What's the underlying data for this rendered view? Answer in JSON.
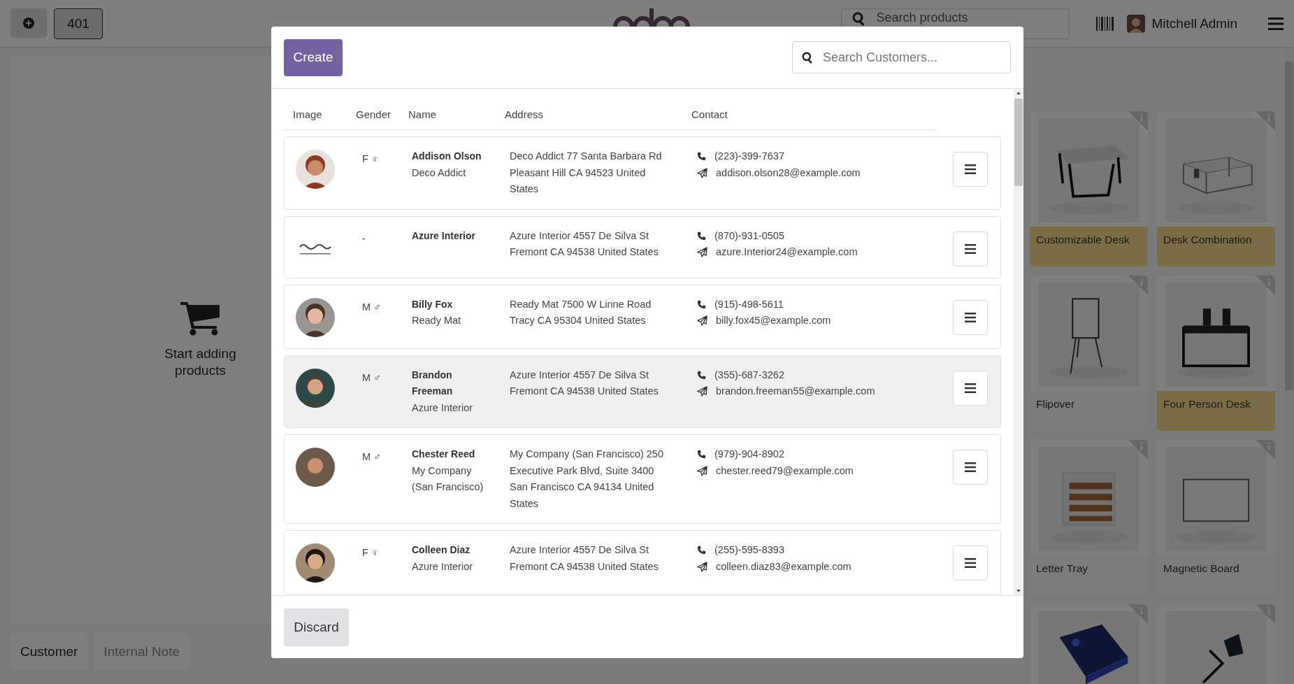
{
  "topbar": {
    "order_number": "401",
    "search": {
      "placeholder": "Search products"
    },
    "user": "Mitchell Admin"
  },
  "order_panel": {
    "empty_message": "Start adding products",
    "buttons": [
      "Customer",
      "Internal Note"
    ]
  },
  "products": [
    {
      "name": "Customizable Desk",
      "highlighted": true,
      "kind": "desk"
    },
    {
      "name": "Desk Combination",
      "highlighted": true,
      "kind": "combo"
    },
    {
      "name": "Flipover",
      "highlighted": false,
      "kind": "flipover"
    },
    {
      "name": "Four Person Desk",
      "highlighted": true,
      "kind": "fourdesk"
    },
    {
      "name": "Letter Tray",
      "highlighted": false,
      "kind": "tray"
    },
    {
      "name": "Magnetic Board",
      "highlighted": false,
      "kind": "board"
    },
    {
      "kind": "box"
    },
    {
      "kind": "lamp"
    }
  ],
  "dialog": {
    "create_button": "Create",
    "search": {
      "placeholder": "Search Customers..."
    },
    "columns": [
      "Image",
      "Gender",
      "Name",
      "Address",
      "Contact"
    ],
    "customers": [
      {
        "gender": "F ♀",
        "name": "Addison Olson",
        "company": "Deco Addict",
        "address": "Deco Addict 77 Santa Barbara Rd Pleasant Hill CA 94523 United States",
        "phone": "(223)-399-7637",
        "email": "addison.olson28@example.com",
        "selected": false
      },
      {
        "kind": "logo",
        "gender": "-",
        "name": "Azure Interior",
        "address": "Azure Interior 4557 De Silva St Fremont CA 94538 United States",
        "phone": "(870)-931-0505",
        "email": "azure.Interior24@example.com",
        "selected": false
      },
      {
        "gender": "M ♂",
        "name": "Billy Fox",
        "company": "Ready Mat",
        "address": "Ready Mat 7500 W Linne Road Tracy CA 95304 United States",
        "phone": "(915)-498-5611",
        "email": "billy.fox45@example.com",
        "selected": false
      },
      {
        "gender": "M ♂",
        "name": "Brandon Freeman",
        "company": "Azure Interior",
        "address": "Azure Interior 4557 De Silva St Fremont CA 94538 United States",
        "phone": "(355)-687-3262",
        "email": "brandon.freeman55@example.com",
        "selected": true
      },
      {
        "gender": "M ♂",
        "name": "Chester Reed",
        "company": "My Company (San Francisco)",
        "address": "My Company (San Francisco) 250 Executive Park Blvd, Suite 3400 San Francisco CA 94134 United States",
        "phone": "(979)-904-8902",
        "email": "chester.reed79@example.com",
        "selected": false
      },
      {
        "gender": "F ♀",
        "name": "Colleen Diaz",
        "company": "Azure Interior",
        "address": "Azure Interior 4557 De Silva St Fremont CA 94538 United States",
        "phone": "(255)-595-8393",
        "email": "colleen.diaz83@example.com",
        "selected": false
      }
    ],
    "discard_button": "Discard"
  }
}
